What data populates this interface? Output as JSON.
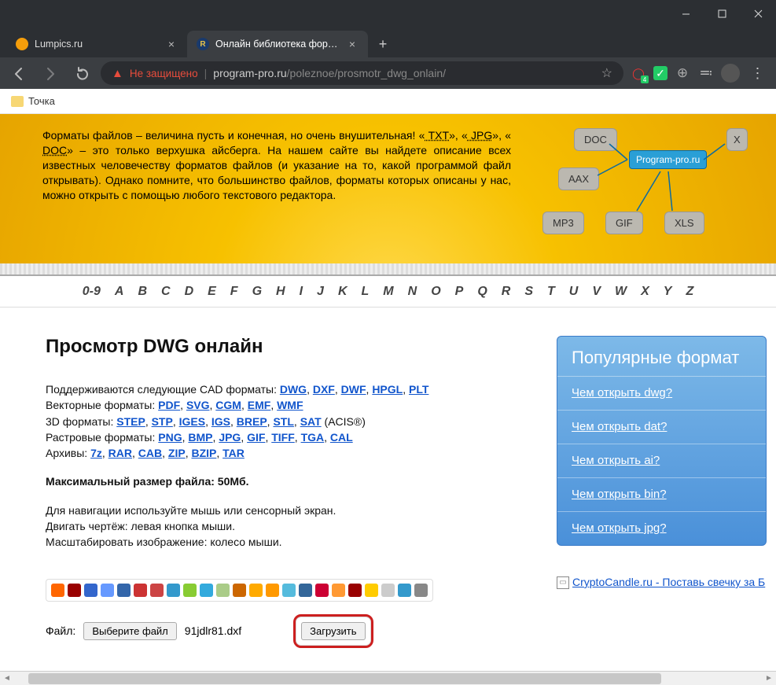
{
  "window": {
    "tabs": [
      {
        "title": "Lumpics.ru",
        "active": false
      },
      {
        "title": "Онлайн библиотека форматов",
        "active": true
      }
    ]
  },
  "omnibox": {
    "not_secure": "Не защищено",
    "url_host": "program-pro.ru",
    "url_path": "/poleznoe/prosmotr_dwg_onlain/",
    "badge_count": "4"
  },
  "bookmarks_bar": {
    "item1": "Точка"
  },
  "intro": {
    "text_before": "Форматы файлов – величина пусть и конечная, но очень внушительная! «",
    "txt": " TXT",
    "mid1": "», «",
    "jpg": " JPG",
    "mid2": "», «",
    "doc": " DOC",
    "text_after": "» – это только верхушка айсберга. На нашем сайте вы найдете описание всех известных человечеству форматов файлов (и указание на то, какой программой файл открывать). Однако помните, что большинство файлов, форматы которых описаны у нас, можно открыть с помощью любого текстового редактора."
  },
  "tags": {
    "doc": "DOC",
    "aax": "AAX",
    "mp3": "MP3",
    "gif": "GIF",
    "xls": "XLS",
    "x": "X",
    "site": "Program-pro.ru"
  },
  "alpha": [
    "0-9",
    "A",
    "B",
    "C",
    "D",
    "E",
    "F",
    "G",
    "H",
    "I",
    "J",
    "K",
    "L",
    "M",
    "N",
    "O",
    "P",
    "Q",
    "R",
    "S",
    "T",
    "U",
    "V",
    "W",
    "X",
    "Y",
    "Z"
  ],
  "main": {
    "h1": "Просмотр DWG онлайн",
    "cad_label": "Поддерживаются следующие CAD форматы: ",
    "cad": [
      "DWG",
      "DXF",
      "DWF",
      "HPGL",
      "PLT"
    ],
    "vec_label": "Векторные форматы: ",
    "vec": [
      "PDF",
      "SVG",
      "CGM",
      "EMF",
      "WMF"
    ],
    "d3_label": "3D форматы: ",
    "d3": [
      "STEP",
      "STP",
      "IGES",
      "IGS",
      "BREP",
      "STL",
      "SAT"
    ],
    "d3_suffix": " (ACIS®)",
    "ras_label": "Растровые форматы: ",
    "ras": [
      "PNG",
      "BMP",
      "JPG",
      "GIF",
      "TIFF",
      "TGA",
      "CAL"
    ],
    "arc_label": "Архивы: ",
    "arc": [
      "7z",
      "RAR",
      "CAB",
      "ZIP",
      "BZIP",
      "TAR"
    ],
    "maxsize": "Максимальный размер файла: 50Мб.",
    "nav1": "Для навигации используйте мышь или сенсорный экран.",
    "nav2": "Двигать чертёж: левая кнопка мыши.",
    "nav3": "Масштабировать изображение: колесо мыши.",
    "file_label": "Файл:",
    "choose_btn": "Выберите файл",
    "filename": "91jdlr81.dxf",
    "upload_btn": "Загрузить"
  },
  "sidebar": {
    "title": "Популярные формат",
    "items": [
      "Чем открыть dwg?",
      "Чем открыть dat?",
      "Чем открыть ai?",
      "Чем открыть bin?",
      "Чем открыть jpg?"
    ],
    "banner": "CryptoCandle.ru - Поставь свечку за Б"
  },
  "share_colors": [
    "#f60",
    "#900",
    "#36c",
    "#69f",
    "#36a",
    "#c33",
    "#c44",
    "#39c",
    "#8c3",
    "#3ad",
    "#ac8",
    "#c60",
    "#fa0",
    "#f90",
    "#5bd",
    "#369",
    "#c03",
    "#f93",
    "#900",
    "#fc0",
    "#ccc",
    "#39c",
    "#888"
  ]
}
